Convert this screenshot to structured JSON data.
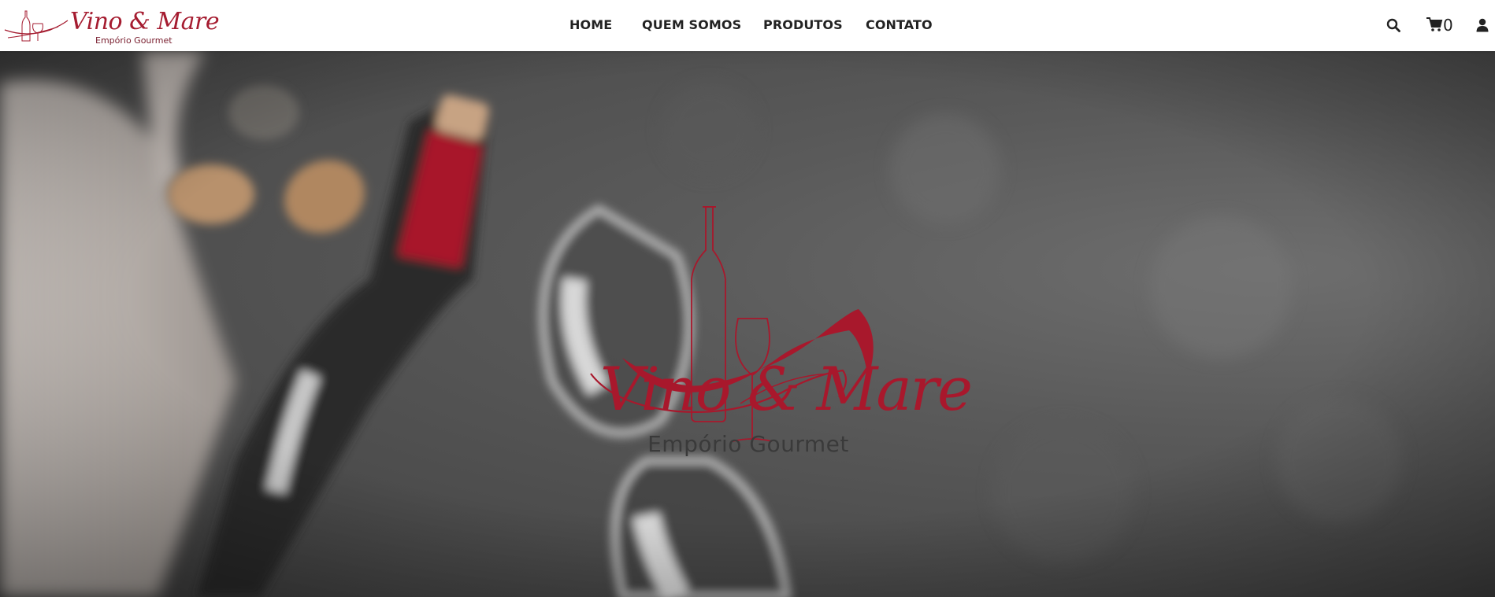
{
  "brand": {
    "name": "Vino & Mare",
    "tagline": "Empório Gourmet",
    "color": "#a8182c"
  },
  "nav": {
    "items": [
      {
        "label": "HOME"
      },
      {
        "label": "QUEM SOMOS"
      },
      {
        "label": "PRODUTOS"
      },
      {
        "label": "CONTATO"
      }
    ]
  },
  "header_actions": {
    "search_icon": "search-icon",
    "cart_icon": "shopping-cart-icon",
    "cart_count": "0",
    "user_icon": "user-icon"
  },
  "hero": {
    "title": "Vino & Mare",
    "subtitle": "Empório Gourmet",
    "background_description_colors": {
      "slate": "#4a4a4a",
      "wine_red": "#a8182c",
      "cork": "#c9a27a"
    }
  }
}
